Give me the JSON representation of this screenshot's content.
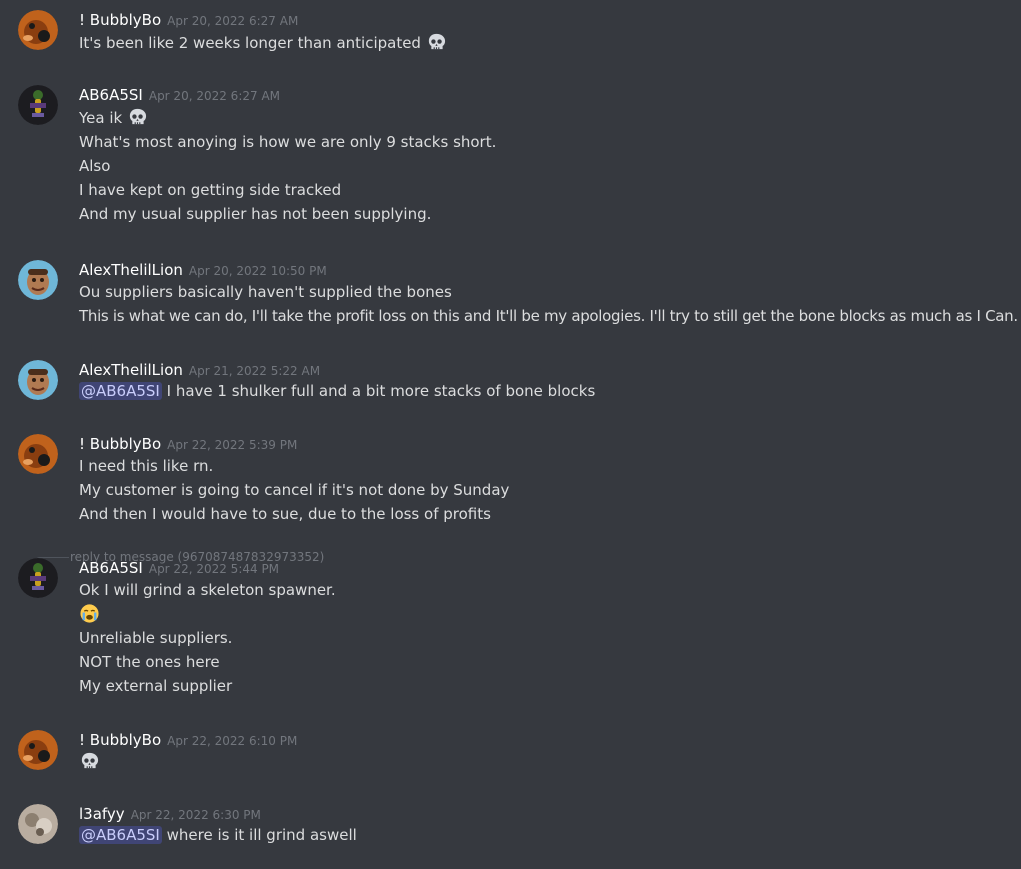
{
  "messages": [
    {
      "author": "! BubblyBo",
      "timestamp": "Apr 20, 2022 6:27 AM",
      "avatar": "fox-avatar",
      "lines": [
        {
          "text": "It's been like 2 weeks longer than anticipated",
          "emoji": "skull"
        }
      ]
    },
    {
      "author": "AB6A5SI",
      "timestamp": "Apr 20, 2022 6:27 AM",
      "avatar": "dark-character-avatar",
      "lines": [
        {
          "text": "Yea ik",
          "emoji": "skull"
        },
        {
          "text": "What's most anoying is how we are only 9 stacks short."
        },
        {
          "text": "Also"
        },
        {
          "text": "I have kept on getting side tracked"
        },
        {
          "text": "And my usual supplier has not been supplying."
        }
      ]
    },
    {
      "author": "AlexThelilLion",
      "timestamp": "Apr 20, 2022 10:50 PM",
      "avatar": "cartoon-face-avatar",
      "lines": [
        {
          "text": "Ou suppliers basically haven't supplied the bones"
        },
        {
          "text": "This is what we can do, I'll take the profit loss on this and It'll be my apologies. I'll try to still get the bone blocks as much as I Can."
        }
      ]
    },
    {
      "author": "AlexThelilLion",
      "timestamp": "Apr 21, 2022 5:22 AM",
      "avatar": "cartoon-face-avatar",
      "lines": [
        {
          "mention": "@AB6A5SI",
          "text": " I have 1 shulker full and a bit more stacks of bone blocks"
        }
      ]
    },
    {
      "author": "! BubblyBo",
      "timestamp": "Apr 22, 2022 5:39 PM",
      "avatar": "fox-avatar",
      "lines": [
        {
          "text": "I need this like rn."
        },
        {
          "text": "My customer is going to cancel if it's not done by Sunday"
        },
        {
          "text": "And then I would have to sue, due to the loss of profits"
        }
      ]
    },
    {
      "author": "AB6A5SI",
      "timestamp": "Apr 22, 2022 5:44 PM",
      "avatar": "dark-character-avatar",
      "reply": "reply to message (967087487832973352)",
      "lines": [
        {
          "text": "Ok I will grind a skeleton spawner."
        },
        {
          "text": "",
          "emoji": "crying-face"
        },
        {
          "text": "Unreliable suppliers."
        },
        {
          "text": "NOT the ones here"
        },
        {
          "text": "My external supplier"
        }
      ]
    },
    {
      "author": "! BubblyBo",
      "timestamp": "Apr 22, 2022 6:10 PM",
      "avatar": "fox-avatar",
      "lines": [
        {
          "text": "",
          "emoji": "skull"
        }
      ]
    },
    {
      "author": "l3afyy",
      "timestamp": "Apr 22, 2022 6:30 PM",
      "avatar": "photo-avatar",
      "lines": [
        {
          "mention": "@AB6A5SI",
          "text": " where is it ill grind aswell"
        }
      ]
    }
  ],
  "colors": {
    "background": "#36393f",
    "author": "#ffffff",
    "timestamp": "#72767d",
    "text": "#dcddde",
    "mention_bg": "#414675",
    "mention_text": "#c9cdfb"
  }
}
